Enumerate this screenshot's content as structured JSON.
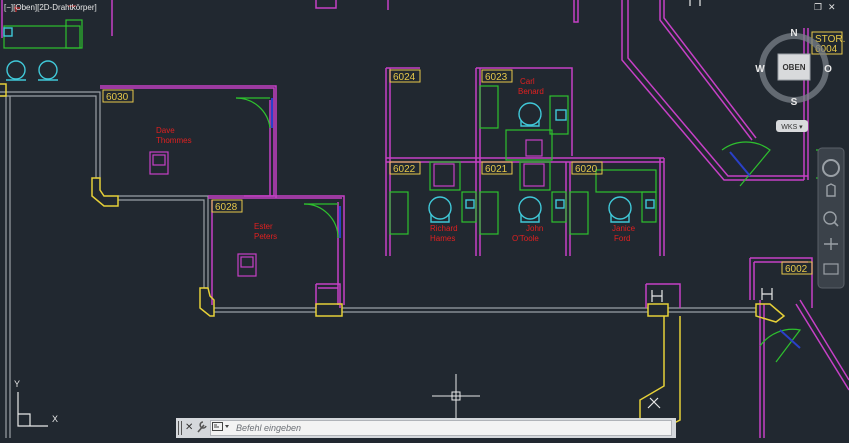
{
  "viewport": {
    "label": "[−][Oben][2D-Drahtkörper]",
    "controls": {
      "restore": "❐",
      "close": "✕"
    }
  },
  "viewcube": {
    "face": "OBEN",
    "north": "N",
    "south": "S",
    "east": "O",
    "west": "W",
    "wcs": "WKS ▾"
  },
  "rooms": [
    "6030",
    "6028",
    "6024",
    "6023",
    "6022",
    "6021",
    "6020",
    "6002",
    "6004"
  ],
  "stor_label": "STOR.",
  "people": [
    {
      "first": "Dave",
      "last": "Thommes"
    },
    {
      "first": "Ester",
      "last": "Peters"
    },
    {
      "first": "Carl",
      "last": "Benard"
    },
    {
      "first": "Richard",
      "last": "Hames"
    },
    {
      "first": "John",
      "last": "O'Toole"
    },
    {
      "first": "Janice",
      "last": "Ford"
    }
  ],
  "ucs": {
    "x": "X",
    "y": "Y"
  },
  "command_line": {
    "placeholder": "Befehl eingeben",
    "close_glyph": "✕",
    "settings_glyph": "🔧"
  },
  "colors": {
    "background": "#212830",
    "wall": "#c640c6",
    "tag": "#e6c84a",
    "name": "#e02020",
    "furniture": "#2ec02e",
    "chair": "#40c8d8",
    "door": "#2ec02e"
  }
}
